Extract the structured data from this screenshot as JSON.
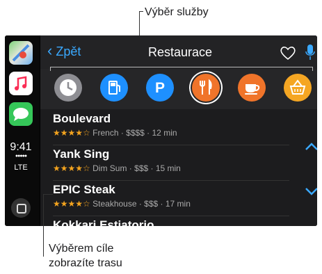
{
  "callouts": {
    "service_selection": "Výběr služby",
    "destination_line1": "Výběrem cíle",
    "destination_line2": "zobrazíte trasu"
  },
  "sidebar": {
    "apps": [
      {
        "name": "maps-app-icon"
      },
      {
        "name": "music-app-icon"
      },
      {
        "name": "messages-app-icon"
      }
    ],
    "time": "9:41",
    "signal": "●●●●●",
    "network": "LTE"
  },
  "navbar": {
    "back_chevron": "‹",
    "back_label": "Zpět",
    "title": "Restaurace"
  },
  "categories": [
    {
      "icon": "clock-icon",
      "color": "#8e8e93"
    },
    {
      "icon": "fuel-icon",
      "color": "#1e90ff"
    },
    {
      "icon": "parking-icon",
      "label": "P",
      "color": "#1e90ff"
    },
    {
      "icon": "fork-knife-icon",
      "color": "#f0742a",
      "selected": true
    },
    {
      "icon": "coffee-icon",
      "color": "#f0742a"
    },
    {
      "icon": "basket-icon",
      "color": "#f5a623"
    }
  ],
  "restaurants": [
    {
      "name": "Boulevard",
      "stars": "★★★★☆",
      "details": "French · $$$$ · 12 min"
    },
    {
      "name": "Yank Sing",
      "stars": "★★★★☆",
      "details": "Dim Sum · $$$ · 15 min"
    },
    {
      "name": "EPIC Steak",
      "stars": "★★★★☆",
      "details": "Steakhouse  · $$$ · 17 min"
    },
    {
      "name": "Kokkari Estiatorio",
      "stars": "",
      "details": ""
    }
  ],
  "scroll": {
    "up": "⌃",
    "down": "⌄"
  },
  "colors": {
    "accent": "#3aa9ff",
    "stars": "#f4a41f"
  }
}
